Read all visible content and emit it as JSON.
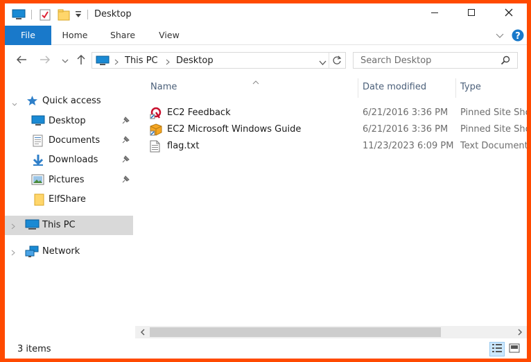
{
  "window": {
    "title": "Desktop",
    "controls": {
      "minimize_icon": "minimize-icon",
      "maximize_icon": "maximize-icon",
      "close_icon": "close-icon"
    }
  },
  "ribbon": {
    "tabs": [
      {
        "label": "File",
        "active": true
      },
      {
        "label": "Home"
      },
      {
        "label": "Share"
      },
      {
        "label": "View"
      }
    ]
  },
  "address": {
    "crumbs": [
      "This PC",
      "Desktop"
    ],
    "search_placeholder": "Search Desktop"
  },
  "nav": {
    "quick_access": "Quick access",
    "items": [
      {
        "label": "Desktop",
        "icon": "desktop-icon",
        "pinned": true
      },
      {
        "label": "Documents",
        "icon": "documents-icon",
        "pinned": true
      },
      {
        "label": "Downloads",
        "icon": "downloads-icon",
        "pinned": true
      },
      {
        "label": "Pictures",
        "icon": "pictures-icon",
        "pinned": true
      },
      {
        "label": "ElfShare",
        "icon": "folder-icon",
        "pinned": false
      }
    ],
    "this_pc": "This PC",
    "network": "Network"
  },
  "columns": {
    "name": "Name",
    "date": "Date modified",
    "type": "Type"
  },
  "files": [
    {
      "name": "EC2 Feedback",
      "date": "6/21/2016 3:36 PM",
      "type": "Pinned Site Sho",
      "icon": "pinned-site-icon"
    },
    {
      "name": "EC2 Microsoft Windows Guide",
      "date": "6/21/2016 3:36 PM",
      "type": "Pinned Site Sho",
      "icon": "pinned-site-icon"
    },
    {
      "name": "flag.txt",
      "date": "11/23/2023 6:09 PM",
      "type": "Text Document",
      "icon": "text-file-icon"
    }
  ],
  "status": {
    "item_count": "3 items"
  },
  "colors": {
    "accent": "#1979ca",
    "selected_nav": "#d9d9d9",
    "border_highlight": "#ff4a00"
  }
}
